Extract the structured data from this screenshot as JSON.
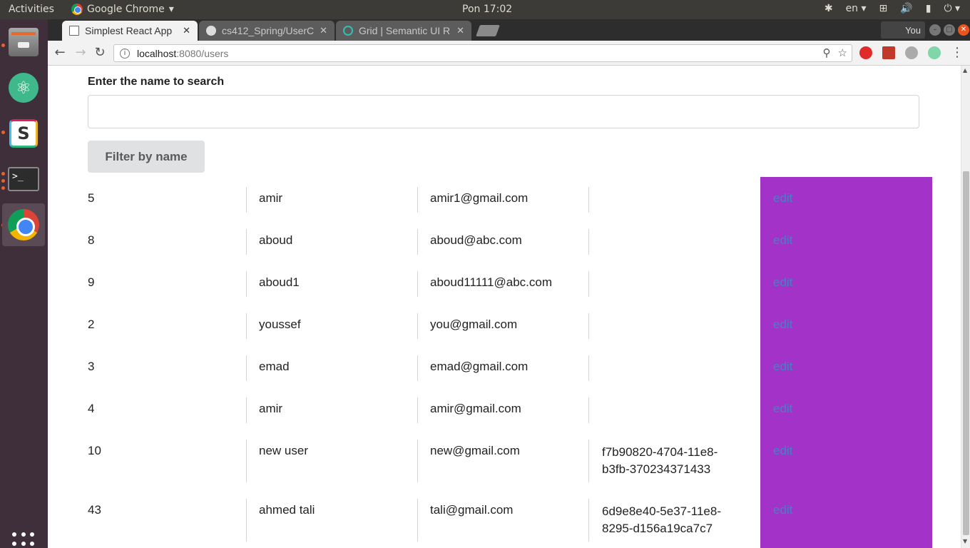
{
  "system_bar": {
    "activities": "Activities",
    "app_name": "Google Chrome",
    "clock": "Pon 17:02",
    "language": "en"
  },
  "browser": {
    "tabs": [
      {
        "label": "Simplest React App",
        "active": true
      },
      {
        "label": "cs412_Spring/UserC",
        "active": false
      },
      {
        "label": "Grid | Semantic UI R",
        "active": false
      }
    ],
    "profile": "You",
    "url_host": "localhost",
    "url_rest": ":8080/users"
  },
  "page": {
    "search_label": "Enter the name to search",
    "search_value": "",
    "filter_button": "Filter by name",
    "edit_color": "#a333c8",
    "link_color": "#4183c4",
    "users": [
      {
        "id": "5",
        "name": "amir",
        "email": "amir1@gmail.com",
        "token": "",
        "action": "edit"
      },
      {
        "id": "8",
        "name": "aboud",
        "email": "aboud@abc.com",
        "token": "",
        "action": "edit"
      },
      {
        "id": "9",
        "name": "aboud1",
        "email": "aboud11111@abc.com",
        "token": "",
        "action": "edit"
      },
      {
        "id": "2",
        "name": "youssef",
        "email": "you@gmail.com",
        "token": "",
        "action": "edit"
      },
      {
        "id": "3",
        "name": "emad",
        "email": "emad@gmail.com",
        "token": "",
        "action": "edit"
      },
      {
        "id": "4",
        "name": "amir",
        "email": "amir@gmail.com",
        "token": "",
        "action": "edit"
      },
      {
        "id": "10",
        "name": "new user",
        "email": "new@gmail.com",
        "token": "f7b90820-4704-11e8-b3fb-370234371433",
        "action": "edit"
      },
      {
        "id": "43",
        "name": "ahmed tali",
        "email": "tali@gmail.com",
        "token": "6d9e8e40-5e37-11e8-8295-d156a19ca7c7",
        "action": "edit"
      }
    ]
  }
}
